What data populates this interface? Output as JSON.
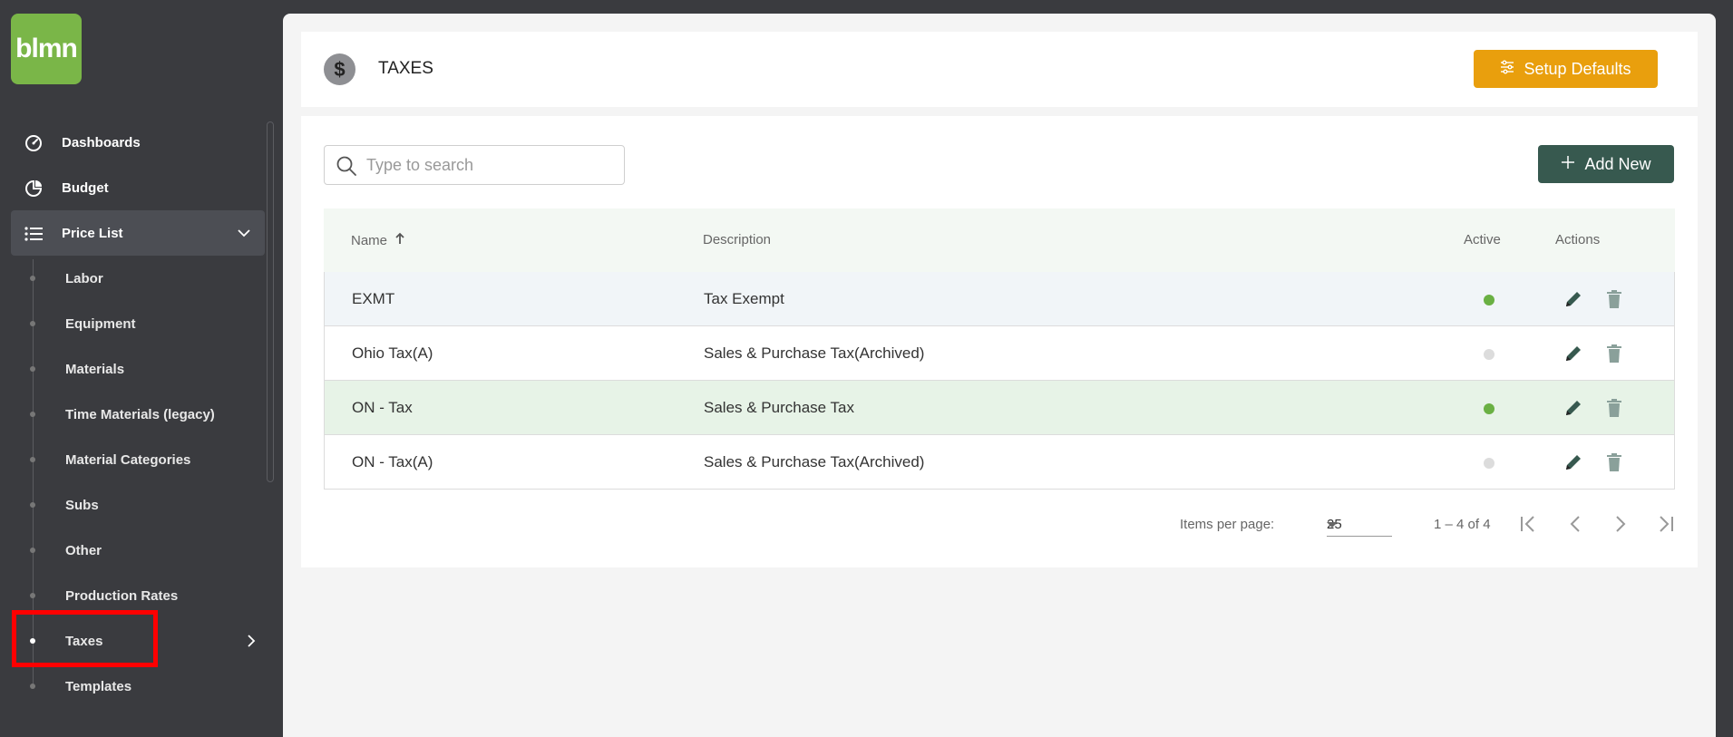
{
  "sidebar": {
    "logo_text": "blmn",
    "items": [
      {
        "label": "Dashboards",
        "icon": "gauge-icon"
      },
      {
        "label": "Budget",
        "icon": "pie-chart-icon"
      },
      {
        "label": "Price List",
        "icon": "list-icon"
      }
    ],
    "sub_items": [
      {
        "label": "Labor"
      },
      {
        "label": "Equipment"
      },
      {
        "label": "Materials"
      },
      {
        "label": "Time Materials (legacy)"
      },
      {
        "label": "Material Categories"
      },
      {
        "label": "Subs"
      },
      {
        "label": "Other"
      },
      {
        "label": "Production Rates"
      },
      {
        "label": "Taxes"
      },
      {
        "label": "Templates"
      }
    ],
    "active_sub": "Taxes"
  },
  "header": {
    "icon": "dollar-icon",
    "title": "TAXES",
    "setup_label": "Setup Defaults"
  },
  "toolbar": {
    "search_placeholder": "Type to search",
    "add_label": "Add New"
  },
  "table": {
    "columns": {
      "name": "Name",
      "description": "Description",
      "active": "Active",
      "actions": "Actions"
    },
    "rows": [
      {
        "name": "EXMT",
        "description": "Tax Exempt",
        "active": true
      },
      {
        "name": "Ohio Tax(A)",
        "description": "Sales & Purchase Tax(Archived)",
        "active": false
      },
      {
        "name": "ON - Tax",
        "description": "Sales & Purchase Tax",
        "active": true
      },
      {
        "name": "ON - Tax(A)",
        "description": "Sales & Purchase Tax(Archived)",
        "active": false
      }
    ]
  },
  "pager": {
    "items_per_page_label": "Items per page:",
    "items_per_page": "25",
    "range": "1 – 4 of 4"
  },
  "colors": {
    "accent_orange": "#e99f0d",
    "accent_green": "#37594f",
    "active_dot": "#6ab043",
    "logo_bg": "#7ab648"
  }
}
